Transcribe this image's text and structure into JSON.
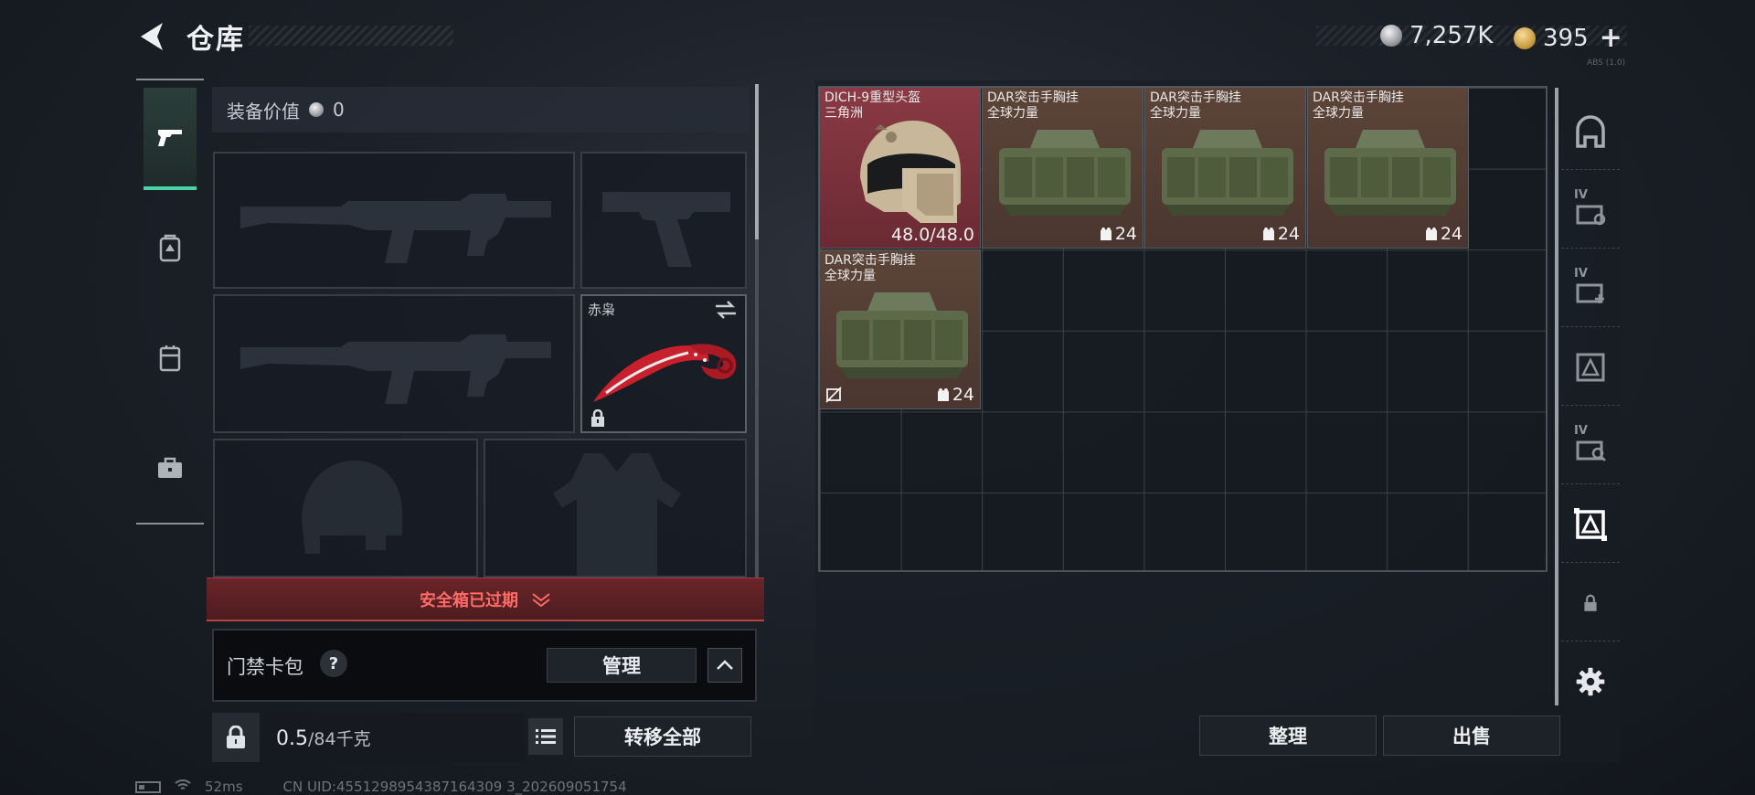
{
  "header": {
    "title": "仓库",
    "currency_silver": "7,257K",
    "currency_gold": "395",
    "plus_label": "+",
    "version": "ABS (1.0)"
  },
  "left_rail": {
    "tabs": [
      {
        "name": "weapons",
        "icon": "pistol-icon",
        "active": true
      },
      {
        "name": "gear",
        "icon": "backpack-badge-icon",
        "active": false
      },
      {
        "name": "armor",
        "icon": "vest-icon",
        "active": false
      },
      {
        "name": "supplies",
        "icon": "case-icon",
        "active": false
      }
    ]
  },
  "equipment": {
    "value_label": "装备价值",
    "value": "0",
    "knife_slot_label": "赤枭",
    "safebox_text": "安全箱已过期",
    "keycard_label": "门禁卡包",
    "keycard_help": "?",
    "manage_label": "管理",
    "weight_current": "0.5",
    "weight_max": "/84",
    "weight_unit": "千克",
    "transfer_all_label": "转移全部"
  },
  "storage": {
    "items": [
      {
        "name_line1": "DICH-9重型头盔",
        "name_line2": "三角洲",
        "durability": "48.0/48.0",
        "color": "#8a3a44"
      },
      {
        "name_line1": "DAR突击手胸挂",
        "name_line2": "全球力量",
        "count": "24",
        "color": "#5c4438"
      },
      {
        "name_line1": "DAR突击手胸挂",
        "name_line2": "全球力量",
        "count": "24",
        "color": "#5c4438"
      },
      {
        "name_line1": "DAR突击手胸挂",
        "name_line2": "全球力量",
        "count": "24",
        "color": "#5c4438"
      },
      {
        "name_line1": "DAR突击手胸挂",
        "name_line2": "全球力量",
        "count": "24",
        "color": "#5c4438"
      }
    ],
    "tidy_label": "整理",
    "sell_label": "出售"
  },
  "right_rail": {
    "tabs": [
      {
        "icon": "helmet-shelf-icon"
      },
      {
        "icon": "storage-iv-icon",
        "level": "IV"
      },
      {
        "icon": "storage-iv-add-icon",
        "level": "IV"
      },
      {
        "icon": "storage-frame-icon"
      },
      {
        "icon": "storage-iv-search-icon",
        "level": "IV"
      },
      {
        "icon": "storage-selected-icon"
      },
      {
        "icon": "lock-icon"
      },
      {
        "icon": "gear-icon"
      }
    ]
  },
  "status": {
    "ping": "52ms",
    "uid": "CN UID:4551298954387164309 3_202609051754"
  },
  "colors": {
    "accent_green": "#4ad3a6",
    "expired_red": "#ff6b66",
    "helmet_item": "#8a3a44",
    "vest_item": "#5c4438"
  }
}
